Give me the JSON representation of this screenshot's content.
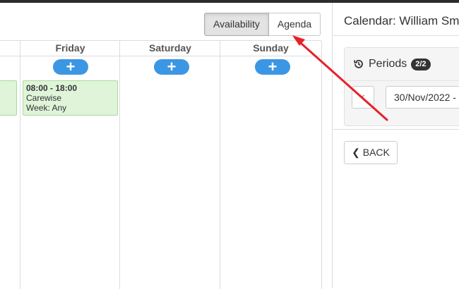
{
  "view_toggle": {
    "availability": "Availability",
    "agenda": "Agenda"
  },
  "calendar": {
    "days": [
      "Friday",
      "Saturday",
      "Sunday"
    ],
    "add_icon": "plus-icon",
    "events": [
      {
        "time": "08:00 - 18:00",
        "title": "Carewise",
        "week": "Week: Any"
      }
    ]
  },
  "panel": {
    "title": "Calendar: William Sm",
    "periods_label": "Periods",
    "periods_badge": "2/2",
    "periods_icon": "history-icon",
    "prev_icon": "chevron-left-icon",
    "date_value": "30/Nov/2022 -",
    "back_label": "BACK"
  },
  "colors": {
    "accent": "#3b97e3",
    "event_bg": "#dff4d9",
    "annotation_arrow": "#e8202a"
  }
}
